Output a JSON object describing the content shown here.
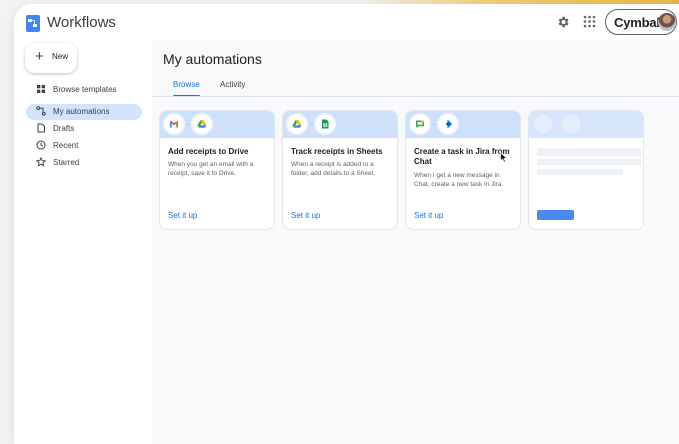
{
  "app": {
    "title": "Workflows"
  },
  "account": {
    "name": "Cymbal"
  },
  "sidebar": {
    "new_label": "New",
    "items": [
      {
        "label": "Browse templates",
        "icon": "grid-icon",
        "active": false
      },
      {
        "label": "My automations",
        "icon": "automation-icon",
        "active": true
      },
      {
        "label": "Drafts",
        "icon": "draft-icon",
        "active": false
      },
      {
        "label": "Recent",
        "icon": "clock-icon",
        "active": false
      },
      {
        "label": "Starred",
        "icon": "star-icon",
        "active": false
      }
    ]
  },
  "main": {
    "title": "My automations",
    "tabs": [
      {
        "label": "Browse",
        "active": true
      },
      {
        "label": "Activity",
        "active": false
      }
    ],
    "cards": [
      {
        "title": "Add receipts to Drive",
        "description": "When you get an email with a receipt, save it to Drive.",
        "link": "Set it up",
        "icons": [
          "gmail-icon",
          "drive-icon"
        ]
      },
      {
        "title": "Track receipts in Sheets",
        "description": "When a receipt is added to a folder, add details to a Sheet.",
        "link": "Set it up",
        "icons": [
          "drive-icon",
          "sheets-icon"
        ]
      },
      {
        "title": "Create a task in Jira from Chat",
        "description": "When I get a new message in Chat, create a new task in Jira.",
        "link": "Set it up",
        "icons": [
          "chat-icon",
          "jira-icon"
        ]
      }
    ]
  },
  "colors": {
    "accent": "#1a73e8",
    "active_nav": "#d3e3fd",
    "card_banner": "#cfe0fb"
  }
}
